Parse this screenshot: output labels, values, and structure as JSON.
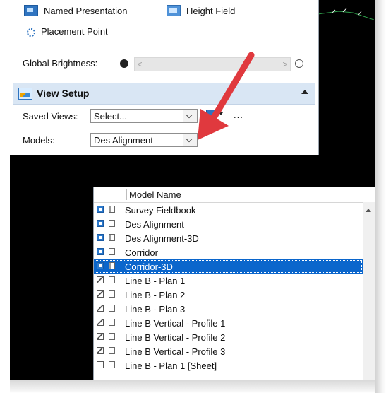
{
  "toolbar_items": {
    "named_presentation": "Named Presentation",
    "height_field": "Height Field",
    "placement_point": "Placement Point"
  },
  "brightness": {
    "label": "Global Brightness:",
    "left_arrow": "<",
    "right_arrow": ">"
  },
  "view_setup": {
    "title": "View Setup",
    "saved_views_label": "Saved Views:",
    "saved_views_value": "Select...",
    "models_label": "Models:",
    "models_value": "Des Alignment",
    "more_label": "..."
  },
  "model_list": {
    "column_header": "Model Name",
    "rows": [
      {
        "name": "Survey Fieldbook",
        "type": "design",
        "selected": false
      },
      {
        "name": "Des Alignment",
        "type": "design",
        "selected": false
      },
      {
        "name": "Des Alignment-3D",
        "type": "design",
        "selected": false
      },
      {
        "name": "Corridor",
        "type": "design",
        "selected": false
      },
      {
        "name": "Corridor-3D",
        "type": "design",
        "selected": true
      },
      {
        "name": "Line B - Plan 1",
        "type": "drawing",
        "selected": false
      },
      {
        "name": "Line B - Plan 2",
        "type": "drawing",
        "selected": false
      },
      {
        "name": "Line B - Plan 3",
        "type": "drawing",
        "selected": false
      },
      {
        "name": "Line B Vertical - Profile 1",
        "type": "drawing",
        "selected": false
      },
      {
        "name": "Line B Vertical - Profile 2",
        "type": "drawing",
        "selected": false
      },
      {
        "name": "Line B Vertical - Profile 3",
        "type": "drawing",
        "selected": false
      },
      {
        "name": "Line B - Plan 1 [Sheet]",
        "type": "sheet",
        "selected": false
      }
    ]
  },
  "colors": {
    "header_bg": "#d9e6f4",
    "selection": "#0b66cc",
    "annotation_arrow": "#e0393e",
    "viewport_bg": "#000000"
  }
}
